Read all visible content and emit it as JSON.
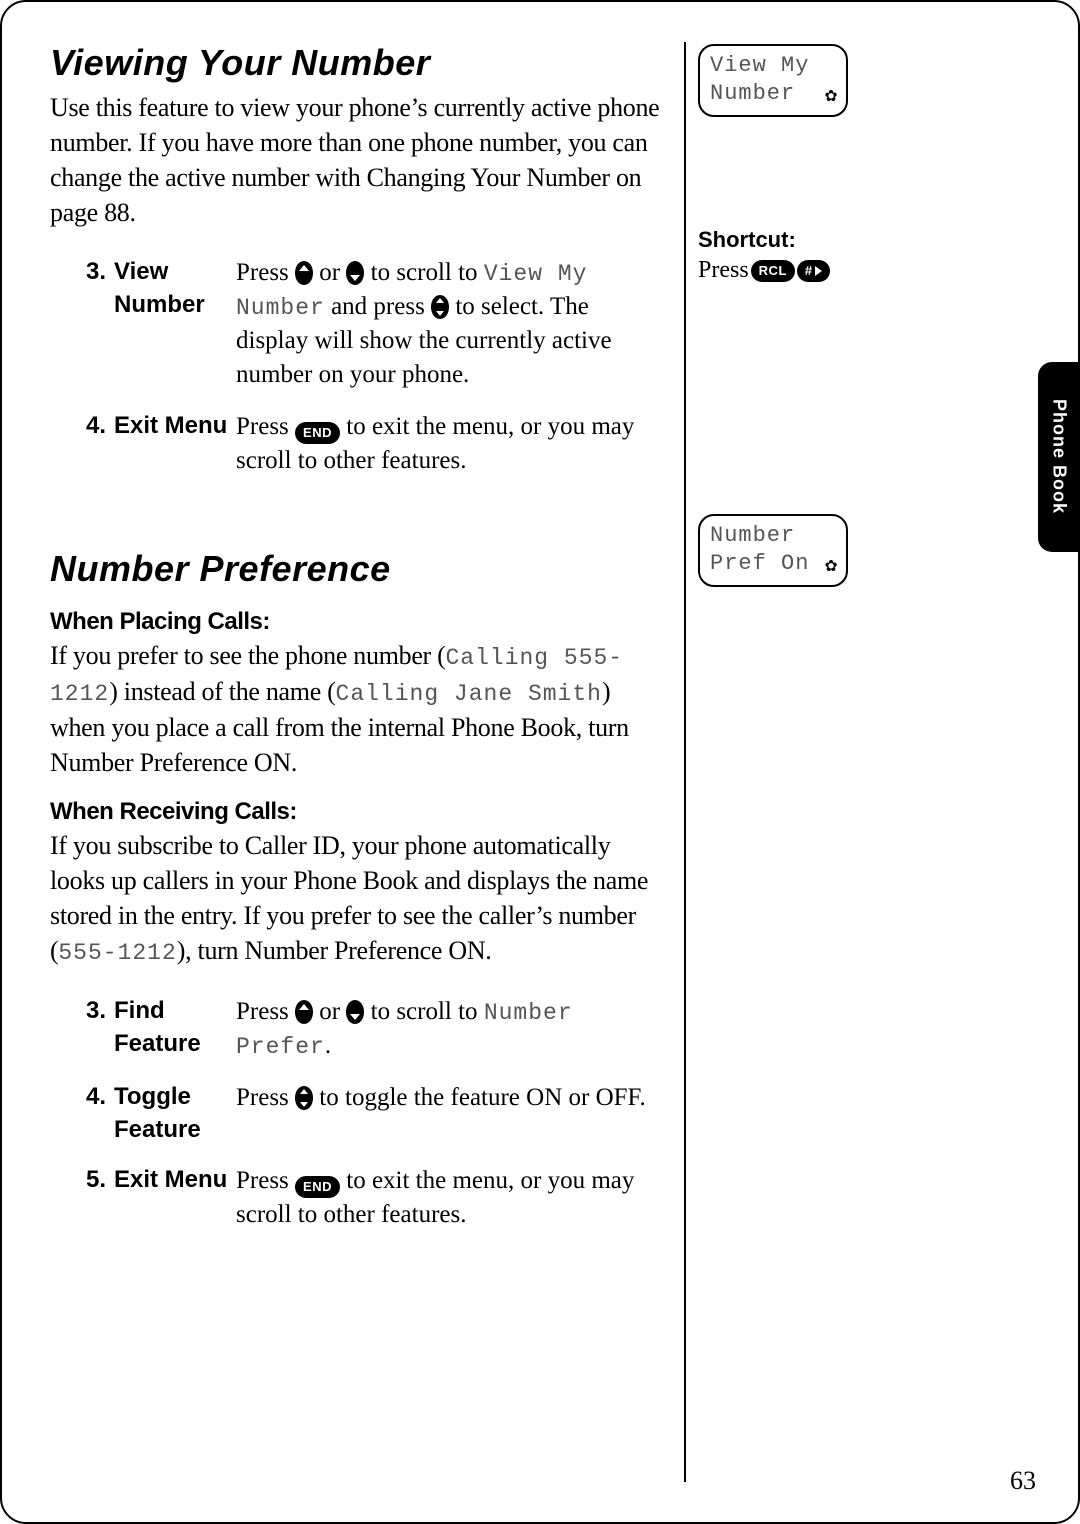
{
  "tab_label": "Phone Book",
  "page_number": "63",
  "section1": {
    "title": "Viewing Your Number",
    "intro": "Use this feature to view your phone’s currently active phone number. If you have more than one phone number, you can change the active number with Changing Your Number on page 88.",
    "lcd_line1": "View My",
    "lcd_line2": "Number",
    "shortcut_label": "Shortcut:",
    "shortcut_press": "Press",
    "shortcut_key1": "RCL",
    "shortcut_key2": "#",
    "steps": [
      {
        "num": "3.",
        "name": "View Number",
        "desc_pre": "Press ",
        "desc_mid": " or ",
        "desc_after_scroll": " to scroll to ",
        "lcd1": "View My",
        "desc_line2_pre": "",
        "lcd2": "Number",
        "desc_line2_mid": " and press ",
        "desc_line2_post": " to select. The display will show the currently active number on your phone."
      },
      {
        "num": "4.",
        "name": "Exit Menu",
        "desc_pre": "Press ",
        "end_key": "END",
        "desc_post": " to exit the menu, or you may scroll to other features."
      }
    ]
  },
  "section2": {
    "title": "Number Preference",
    "sub1_title": "When Placing Calls:",
    "sub1_pre": "If you prefer to see the phone number (",
    "sub1_lcd1": "Calling 555-1212",
    "sub1_mid": ") instead of the name (",
    "sub1_lcd2": "Calling Jane Smith",
    "sub1_post": ") when you place a call from the internal Phone Book, turn Number Preference ON.",
    "sub2_title": "When Receiving Calls:",
    "sub2_pre": "If you subscribe to Caller ID, your phone automatically looks up callers in your Phone Book and displays the name stored in the entry. If you prefer to see the caller’s number (",
    "sub2_lcd": "555-1212",
    "sub2_post": "), turn Number Preference ON.",
    "lcd_line1": "Number",
    "lcd_line2": "Pref On",
    "steps": [
      {
        "num": "3.",
        "name": "Find Feature",
        "desc_pre": "Press ",
        "desc_mid": " or ",
        "desc_after": " to scroll to ",
        "lcd": "Number Prefer",
        "desc_end": "."
      },
      {
        "num": "4.",
        "name": "Toggle Feature",
        "desc_pre": "Press ",
        "desc_post": " to toggle the feature ON or OFF."
      },
      {
        "num": "5.",
        "name": "Exit Menu",
        "desc_pre": "Press ",
        "end_key": "END",
        "desc_post": " to exit the menu, or you may scroll to other features."
      }
    ]
  }
}
